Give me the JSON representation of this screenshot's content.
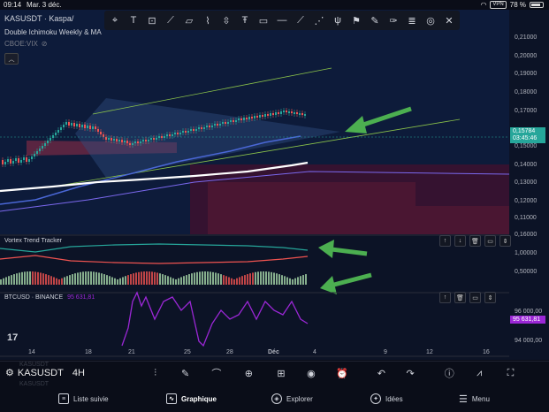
{
  "status_bar": {
    "time": "09:14",
    "date": "Mar. 3 déc.",
    "vpn": "VPN",
    "battery": "78 %"
  },
  "symbol": {
    "title": "KASUSDT · Kaspa/",
    "ticker": "KASUSDT",
    "interval": "4H"
  },
  "indicators": {
    "main": "Double Ichimoku Weekly & MA",
    "secondary": "CBOE:VIX",
    "vortex": "Vortex Trend Tracker",
    "btc": "BTCUSD · BINANCE",
    "btc_value": "95 631,81"
  },
  "price_axis": [
    "0,21000",
    "0,20000",
    "0,19000",
    "0,18000",
    "0,17000",
    "0,16000",
    "0,15000",
    "0,14000",
    "0,13000",
    "0,12000",
    "0,11000",
    "1,00000",
    "0,50000",
    "96 000,00",
    "94 000,00"
  ],
  "price_tag": {
    "price": "0,15784",
    "countdown": "03:45:46"
  },
  "time_axis": [
    "14",
    "18",
    "21",
    "25",
    "28",
    "Déc",
    "4",
    "9",
    "12",
    "16"
  ],
  "ghost_labels": [
    "KASUSDT",
    "4H"
  ],
  "drawing_tools": [
    "cursor-icon",
    "text-icon",
    "date-range-icon",
    "trend-line-icon",
    "parallelogram-icon",
    "path-icon",
    "price-range-icon",
    "t-text-icon",
    "note-icon",
    "horizontal-line-icon",
    "ray-icon",
    "fan-icon",
    "pitchfork-icon",
    "flag-icon",
    "brush-icon",
    "pen-icon",
    "fib-icon",
    "circle-icon",
    "cross-icon"
  ],
  "bottom_tools": [
    "indicators-icon",
    "draw-icon",
    "brush-icon",
    "add-icon",
    "layout-icon",
    "screenshot-icon",
    "alert-icon",
    "undo-icon",
    "redo-icon",
    "info-icon",
    "chart-type-icon",
    "fullscreen-icon"
  ],
  "tabs": [
    {
      "label": "Liste suivie",
      "icon": "watchlist-icon",
      "active": false
    },
    {
      "label": "Graphique",
      "icon": "chart-icon",
      "active": true
    },
    {
      "label": "Explorer",
      "icon": "explore-icon",
      "active": false
    },
    {
      "label": "Idées",
      "icon": "ideas-icon",
      "active": false
    },
    {
      "label": "Menu",
      "icon": "menu-icon",
      "active": false
    }
  ],
  "colors": {
    "up": "#26a69a",
    "down": "#ef5350",
    "accent": "#2962ff",
    "btc": "#9b27d6",
    "arrow": "#4caf50"
  }
}
